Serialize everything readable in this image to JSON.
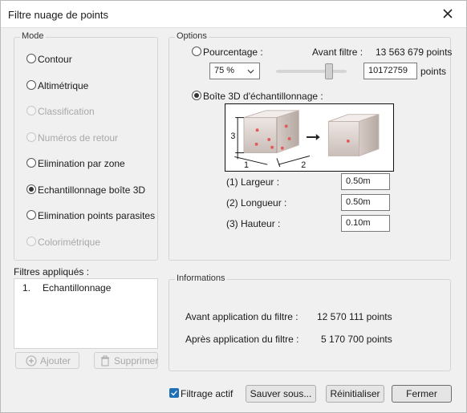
{
  "window": {
    "title": "Filtre nuage de points"
  },
  "mode": {
    "title": "Mode",
    "items": [
      {
        "label": "Contour",
        "checked": false,
        "disabled": false
      },
      {
        "label": "Altimétrique",
        "checked": false,
        "disabled": false
      },
      {
        "label": "Classification",
        "checked": false,
        "disabled": true
      },
      {
        "label": "Numéros de retour",
        "checked": false,
        "disabled": true
      },
      {
        "label": "Elimination par zone",
        "checked": false,
        "disabled": false
      },
      {
        "label": "Echantillonnage boîte 3D",
        "checked": true,
        "disabled": false
      },
      {
        "label": "Elimination points parasites",
        "checked": false,
        "disabled": false
      },
      {
        "label": "Colorimétrique",
        "checked": false,
        "disabled": true
      }
    ]
  },
  "options": {
    "title": "Options",
    "pourcentage_label": "Pourcentage :",
    "avant_filtre_label": "Avant filtre :",
    "avant_filtre_value": "13 563 679 points",
    "percent_select": "75 %",
    "slider_level": 0.75,
    "points_field": "10172759",
    "points_unit": "points",
    "boite_label": "Boîte 3D d'échantillonnage :",
    "diagram_labels": {
      "d1": "1",
      "d2": "2",
      "d3": "3"
    },
    "largeur_label": "(1) Largeur :",
    "largeur_value": "0.50m",
    "longueur_label": "(2) Longueur :",
    "longueur_value": "0.50m",
    "hauteur_label": "(3) Hauteur :",
    "hauteur_value": "0.10m"
  },
  "filters": {
    "title": "Filtres appliqués :",
    "items": [
      {
        "num": "1.",
        "label": "Echantillonnage"
      }
    ],
    "add_label": "Ajouter",
    "delete_label": "Supprimer"
  },
  "info": {
    "title": "Informations",
    "before_label": "Avant application du filtre :",
    "before_value": "12 570 111 points",
    "after_label": "Après application du filtre :",
    "after_value": "5 170 700 points"
  },
  "footer": {
    "filtrage_label": "Filtrage actif",
    "save_label": "Sauver sous...",
    "reset_label": "Réinitialiser",
    "close_label": "Fermer"
  }
}
